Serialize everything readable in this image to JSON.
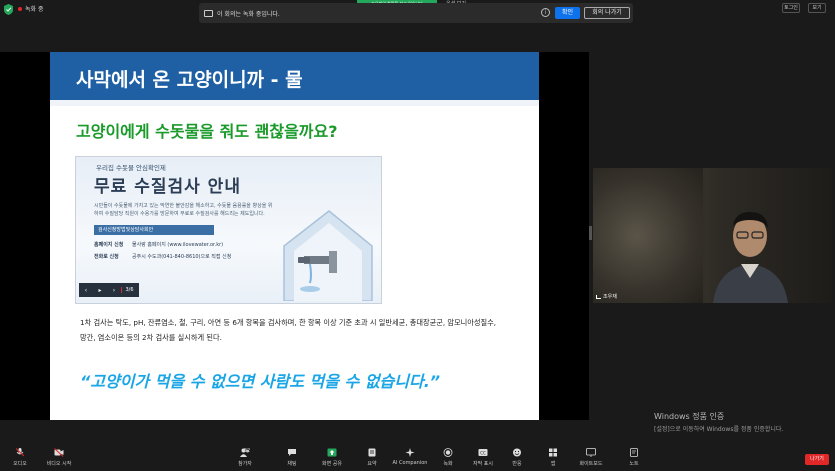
{
  "topbar": {
    "recording_label": "녹화 중",
    "notice_message": "이 회의는 녹화 중입니다.",
    "ok_label": "확인",
    "leave_meeting_label": "회의 나가기",
    "green_banner": "조우재의 화면을 보고 있습니다",
    "view_options_label": "옵션 보기",
    "zoom_label": "토그인",
    "fullscreen_label": "보기"
  },
  "slide": {
    "title": "사막에서 온 고양이니까 - 물",
    "subheading": "고양이에게 수돗물을 줘도 괜찮을까요?",
    "poster": {
      "small_title": "우리집 수돗물 안심확인제",
      "big_title": "무료 수질검사 안내",
      "description": "시민들이 수돗물에 가지고 있는 막연한 불안감을 해소하고, 수돗물 음용률을 향상을 위하여 수질담당 직원이 수용가를 방문하여 무료로 수질검사를 해드리는 제도입니다.",
      "tag": "검사신청방법및상담사회안",
      "rows": [
        {
          "label": "홈페이지 신청",
          "value": "물사랑 홈페이지 (www.ilovewater.or.kr)"
        },
        {
          "label": "전화로 신청",
          "value": "공주시 수도과(041-840-8610)으로 직접 신청"
        }
      ],
      "nav_prev": "‹",
      "nav_play": "▸",
      "nav_next": "›",
      "page_indicator": "3/6"
    },
    "body_text": "1차 검사는 탁도, pH, 잔류염소, 철, 구리, 아연 등 6개 항목을 검사하며, 한 항목 이상 기준 초과 시 일반세균, 총대장균군, 암모니아성질수, 망간, 염소이온 등의 2차 검사를 실시하게 된다.",
    "quote": "“고양이가 먹을 수 없으면 사람도 먹을 수 없습니다.”"
  },
  "video": {
    "participant_name": "조우재"
  },
  "windows_activation": {
    "title": "Windows 정품 인증",
    "message": "[설정]으로 이동하여 Windows를 정품 인증합니다."
  },
  "toolbar": {
    "audio_label": "오디오",
    "video_label": "비디오 시작",
    "participants_label": "참가자",
    "participants_count": "32",
    "chat_label": "채팅",
    "share_label": "화면 공유",
    "summary_label": "요약",
    "companion_label": "AI Companion",
    "record_label": "녹화",
    "captions_label": "자막 표시",
    "reactions_label": "반응",
    "apps_label": "앱",
    "whiteboard_label": "화이트보드",
    "notes_label": "노트",
    "leave_label": "나가기"
  },
  "colors": {
    "slide_header": "#1f60a5",
    "subheading": "#1a9a2a",
    "quote": "#1aa6e6",
    "primary_button": "#0e72ed",
    "leave": "#e02828",
    "share_green": "#23a85b"
  }
}
